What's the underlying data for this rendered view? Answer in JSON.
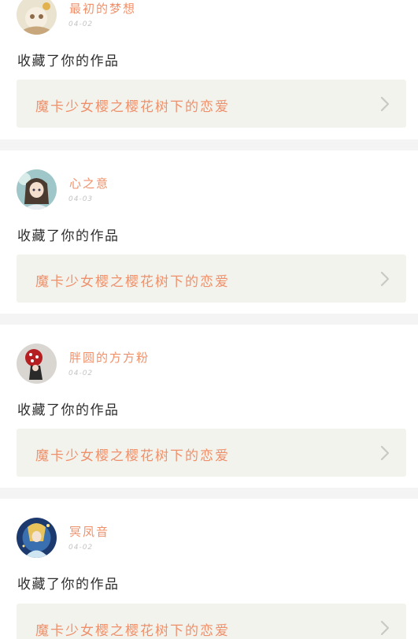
{
  "notifications": [
    {
      "user": "最初的梦想",
      "date": "04-02",
      "action": "收藏了你的作品",
      "work_title": "魔卡少女樱之樱花树下的恋爱",
      "avatar_icon": "avatar-illustration",
      "chevron_icon": "chevron-right-icon"
    },
    {
      "user": "心之意",
      "date": "04-03",
      "action": "收藏了你的作品",
      "work_title": "魔卡少女樱之樱花树下的恋爱",
      "avatar_icon": "avatar-girl-teal",
      "chevron_icon": "chevron-right-icon"
    },
    {
      "user": "胖圆的方方粉",
      "date": "04-02",
      "action": "收藏了你的作品",
      "work_title": "魔卡少女樱之樱花树下的恋爱",
      "avatar_icon": "avatar-red-dot-figure",
      "chevron_icon": "chevron-right-icon"
    },
    {
      "user": "冥凤音",
      "date": "04-02",
      "action": "收藏了你的作品",
      "work_title": "魔卡少女樱之樱花树下的恋爱",
      "avatar_icon": "avatar-blue-gold",
      "chevron_icon": "chevron-right-icon"
    }
  ],
  "colors": {
    "accent": "#f0906a",
    "card_bg": "#ffffff",
    "page_bg": "#f4f4f4",
    "link_bg": "#f3f3ed",
    "badge": "#ef6c9a"
  }
}
